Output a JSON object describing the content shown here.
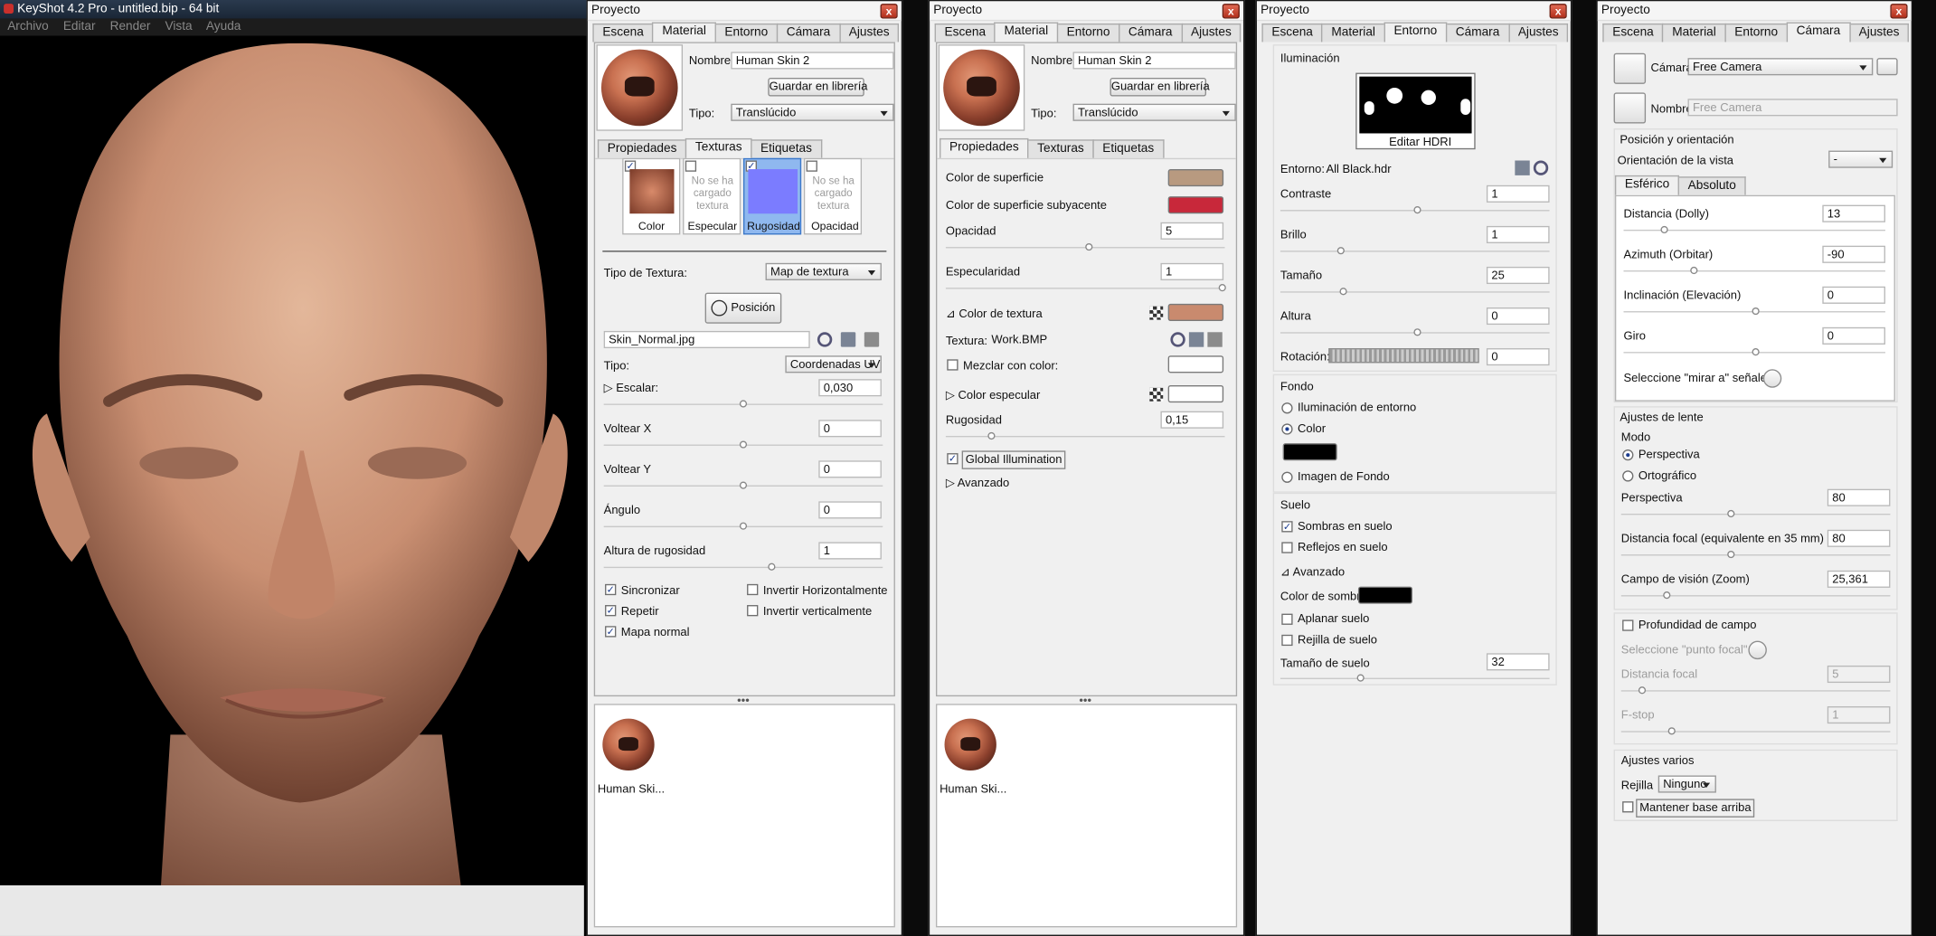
{
  "main": {
    "title": "KeyShot 4.2 Pro  - untitled.bip  - 64 bit",
    "menu": [
      "Archivo",
      "Editar",
      "Render",
      "Vista",
      "Ayuda"
    ]
  },
  "tab_labels": [
    "Escena",
    "Material",
    "Entorno",
    "Cámara",
    "Ajustes"
  ],
  "panel_title": "Proyecto",
  "panel1": {
    "name_label": "Nombre:",
    "name_value": "Human Skin 2",
    "save_button": "Guardar en librería",
    "type_label": "Tipo:",
    "type_value": "Translúcido",
    "subtabs": [
      "Propiedades",
      "Texturas",
      "Etiquetas"
    ],
    "slots": [
      {
        "label": "Color",
        "checked": true
      },
      {
        "label": "Especular",
        "checked": false,
        "empty": "No se ha cargado textura"
      },
      {
        "label": "Rugosidad",
        "checked": true
      },
      {
        "label": "Opacidad",
        "checked": false,
        "empty": "No se ha cargado textura"
      }
    ],
    "texture_type_label": "Tipo de Textura:",
    "texture_type_value": "Map de textura",
    "position_button": "Posición",
    "file_value": "Skin_Normal.jpg",
    "mapping_label": "Tipo:",
    "mapping_value": "Coordenadas UV",
    "rows": [
      {
        "label": "Escalar:",
        "value": "0,030"
      },
      {
        "label": "Voltear X",
        "value": "0"
      },
      {
        "label": "Voltear Y",
        "value": "0"
      },
      {
        "label": "Ángulo",
        "value": "0"
      },
      {
        "label": "Altura de rugosidad",
        "value": "1"
      }
    ],
    "checks_left": [
      "Sincronizar",
      "Repetir",
      "Mapa normal"
    ],
    "checks_right": [
      "Invertir Horizontalmente",
      "Invertir verticalmente"
    ],
    "library_item": "Human Ski..."
  },
  "panel2": {
    "name_value": "Human Skin 2",
    "type_value": "Translúcido",
    "surface_color_label": "Color de superficie",
    "surface_color": "#b89a80",
    "subsurface_color_label": "Color de superficie subyacente",
    "subsurface_color": "#c8283a",
    "opacity_label": "Opacidad",
    "opacity_value": "5",
    "specularity_label": "Especularidad",
    "specularity_value": "1",
    "texture_color_label": "Color de textura",
    "texture_label": "Textura:",
    "texture_value": "Work.BMP",
    "mix_label": "Mezclar con color:",
    "specular_color_label": "Color especular",
    "roughness_label": "Rugosidad",
    "roughness_value": "0,15",
    "gi_label": "Global Illumination",
    "advanced_label": "Avanzado",
    "library_item": "Human Ski..."
  },
  "panel3": {
    "lighting_header": "Iluminación",
    "edit_hdri": "Editar HDRI",
    "env_label": "Entorno:",
    "env_value": "All Black.hdr",
    "rows": [
      {
        "label": "Contraste",
        "value": "1"
      },
      {
        "label": "Brillo",
        "value": "1"
      },
      {
        "label": "Tamaño",
        "value": "25"
      },
      {
        "label": "Altura",
        "value": "0"
      }
    ],
    "rotation_label": "Rotación:",
    "rotation_value": "0",
    "background_header": "Fondo",
    "bg_options": [
      "Iluminación de entorno",
      "Color",
      "Imagen de Fondo"
    ],
    "bg_color": "#000000",
    "ground_header": "Suelo",
    "ground_checks": [
      "Sombras en suelo",
      "Reflejos en suelo"
    ],
    "advanced_label": "Avanzado",
    "shadow_color_label": "Color de sombra",
    "flatten_label": "Aplanar suelo",
    "grid_label": "Rejilla de suelo",
    "ground_size_label": "Tamaño de suelo",
    "ground_size_value": "32"
  },
  "panel4": {
    "camera_label": "Cámara",
    "camera_value": "Free Camera",
    "name_label": "Nombre",
    "name_placeholder": "Free Camera",
    "pos_header": "Posición y orientación",
    "view_orient_label": "Orientación de la vista",
    "view_orient_value": "-",
    "subtabs": [
      "Esférico",
      "Absoluto"
    ],
    "rows": [
      {
        "label": "Distancia (Dolly)",
        "value": "13"
      },
      {
        "label": "Azimuth (Orbitar)",
        "value": "-90"
      },
      {
        "label": "Inclinación (Elevación)",
        "value": "0"
      },
      {
        "label": "Giro",
        "value": "0"
      }
    ],
    "look_at_label": "Seleccione \"mirar a\" señale",
    "lens_header": "Ajustes de lente",
    "mode_label": "Modo",
    "modes": [
      "Perspectiva",
      "Ortográfico"
    ],
    "lens_rows": [
      {
        "label": "Perspectiva",
        "value": "80"
      },
      {
        "label": "Distancia focal (equivalente en 35 mm)",
        "value": "80"
      },
      {
        "label": "Campo de visión (Zoom)",
        "value": "25,361"
      }
    ],
    "dof_label": "Profundidad de campo",
    "focal_point_label": "Seleccione \"punto focal\"",
    "focal_distance_label": "Distancia focal",
    "focal_distance_value": "5",
    "fstop_label": "F-stop",
    "fstop_value": "1",
    "misc_header": "Ajustes varios",
    "grid_label": "Rejilla",
    "grid_value": "Ninguno",
    "keep_base_label": "Mantener base arriba"
  }
}
